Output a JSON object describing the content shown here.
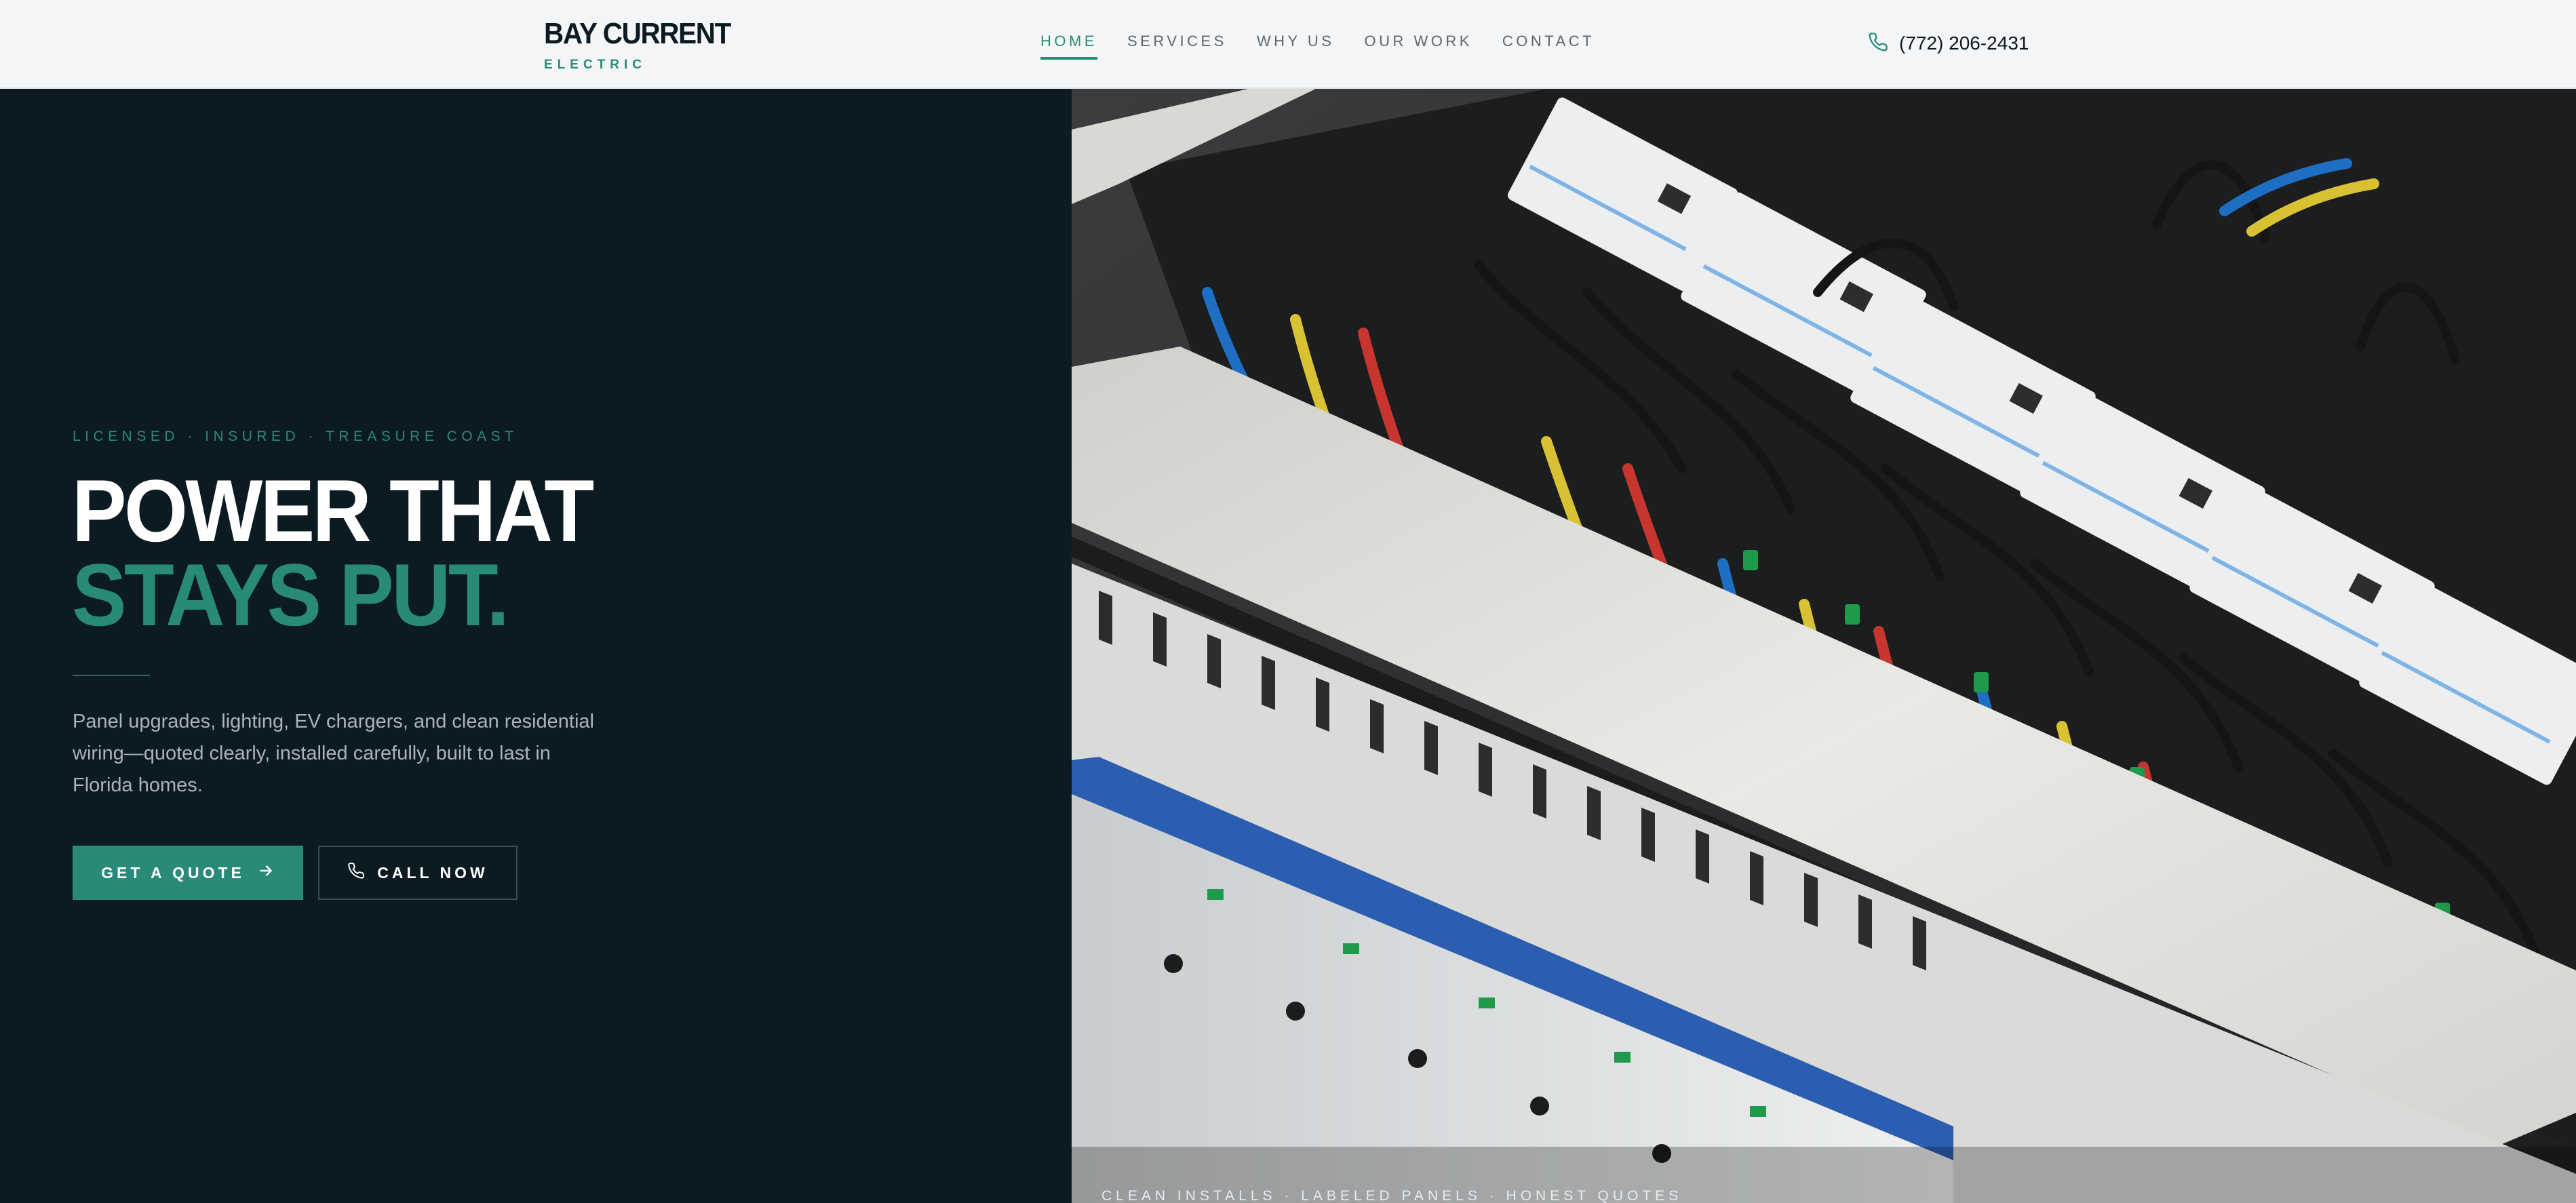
{
  "brand": {
    "name": "BAY CURRENT",
    "tagline": "ELECTRIC"
  },
  "nav": {
    "items": [
      {
        "label": "HOME",
        "active": true
      },
      {
        "label": "SERVICES",
        "active": false
      },
      {
        "label": "WHY US",
        "active": false
      },
      {
        "label": "OUR WORK",
        "active": false
      },
      {
        "label": "CONTACT",
        "active": false
      }
    ]
  },
  "header": {
    "phone": "(772) 206-2431",
    "phone_icon": "phone-icon"
  },
  "hero": {
    "eyebrow": "LICENSED · INSURED · TREASURE COAST",
    "headline_line1": "POWER THAT",
    "headline_line2": "STAYS PUT.",
    "lead": "Panel upgrades, lighting, EV chargers, and clean residential wiring—quoted clearly, installed carefully, built to last in Florida homes.",
    "primary_cta": "GET A QUOTE",
    "primary_cta_icon": "arrow-right-icon",
    "secondary_cta": "CALL NOW",
    "secondary_cta_icon": "phone-icon",
    "image_caption": "CLEAN INSTALLS · LABELED PANELS · HONEST QUOTES"
  },
  "colors": {
    "accent": "#2a8a78",
    "dark": "#0c1a22",
    "header_bg": "#f3f5f7",
    "muted_text": "#a9b3ba"
  }
}
